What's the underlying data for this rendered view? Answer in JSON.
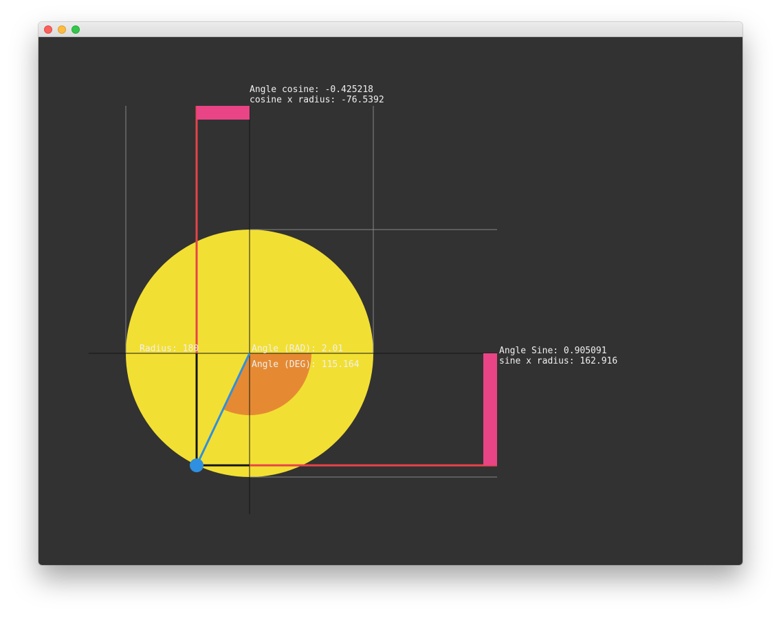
{
  "window": {
    "controls": [
      "close",
      "minimize",
      "zoom"
    ]
  },
  "colors": {
    "background": "#323232",
    "circle": "#f2df33",
    "arc": "#e58a33",
    "red": "#e8424a",
    "pink": "#e94486",
    "blue": "#2f8fe0",
    "guide": "#888888",
    "axis": "#141414"
  },
  "labels": {
    "cosine": "Angle cosine: -0.425218",
    "cosine_radius": "cosine x radius: -76.5392",
    "radius": "Radius: 180",
    "angle_rad": "Angle (RAD): 2.01",
    "angle_deg": "Angle (DEG): 115.164",
    "sine": "Angle Sine: 0.905091",
    "sine_radius": "sine x radius: 162.916"
  },
  "values": {
    "radius": 180,
    "angle_rad": 2.01,
    "angle_deg": 115.164,
    "cosine": -0.425218,
    "sine": 0.905091,
    "cosine_x_radius": -76.5392,
    "sine_x_radius": 162.916
  }
}
